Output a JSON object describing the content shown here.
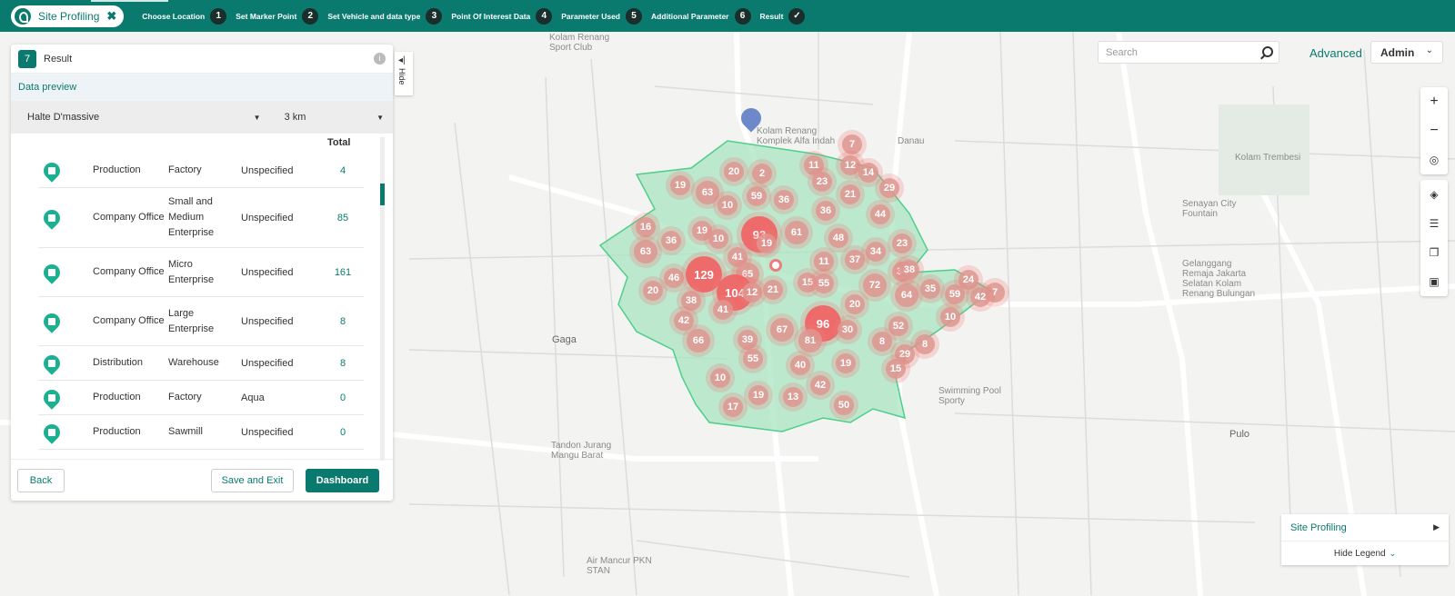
{
  "app": {
    "name": "Site Profiling",
    "close_symbol": "✖",
    "accent": "#0b7a6e"
  },
  "steps": [
    {
      "label": "Choose Location",
      "num": "1"
    },
    {
      "label": "Set Marker Point",
      "num": "2"
    },
    {
      "label": "Set Vehicle and data type",
      "num": "3"
    },
    {
      "label": "Point Of Interest Data",
      "num": "4"
    },
    {
      "label": "Parameter Used",
      "num": "5"
    },
    {
      "label": "Additional Parameter",
      "num": "6"
    },
    {
      "label": "Result",
      "num": "✓"
    }
  ],
  "panel": {
    "step_num": "7",
    "title": "Result",
    "info_symbol": "i",
    "preview_label": "Data preview",
    "location": "Halte D'massive",
    "radius": "3 km",
    "total_header": "Total",
    "rows": [
      {
        "icon": "factory-pin-icon",
        "group": "Production",
        "category": "Factory",
        "brand": "Unspecified",
        "total": "4"
      },
      {
        "icon": "office-pin-icon",
        "group": "Company Office",
        "category": "Small and Medium Enterprise",
        "brand": "Unspecified",
        "total": "85"
      },
      {
        "icon": "office-pin-icon",
        "group": "Company Office",
        "category": "Micro Enterprise",
        "brand": "Unspecified",
        "total": "161"
      },
      {
        "icon": "office-pin-icon",
        "group": "Company Office",
        "category": "Large Enterprise",
        "brand": "Unspecified",
        "total": "8"
      },
      {
        "icon": "warehouse-pin-icon",
        "group": "Distribution",
        "category": "Warehouse",
        "brand": "Unspecified",
        "total": "8"
      },
      {
        "icon": "factory-pin-icon",
        "group": "Production",
        "category": "Factory",
        "brand": "Aqua",
        "total": "0"
      },
      {
        "icon": "sawmill-pin-icon",
        "group": "Production",
        "category": "Sawmill",
        "brand": "Unspecified",
        "total": "0"
      }
    ],
    "back": "Back",
    "save_exit": "Save and Exit",
    "dashboard": "Dashboard",
    "hide": "Hide",
    "hide_arrow": "◂|"
  },
  "search": {
    "placeholder": "Search"
  },
  "advanced": "Advanced",
  "admin": "Admin",
  "map_tools": {
    "zoom_in": "+",
    "zoom_out": "−"
  },
  "legend": {
    "item": "Site Profiling",
    "hide": "Hide Legend"
  },
  "map_labels": [
    "Kolam Renang Sport Club",
    "Gaga",
    "Pulo",
    "Kolam Renang Komplek Alfa Indah",
    "Danau",
    "Senayan City Fountain",
    "Swimming Pool Sporty",
    "Tandon Jurang Mangu Barat",
    "Air Mancur PKN STAN",
    "Kolam Trembesi",
    "Gelanggang Remaja Jakarta Selatan Kolam Renang Bulungan"
  ],
  "clusters": [
    {
      "v": "7"
    },
    {
      "v": "11"
    },
    {
      "v": "12"
    },
    {
      "v": "14"
    },
    {
      "v": "20"
    },
    {
      "v": "2"
    },
    {
      "v": "23"
    },
    {
      "v": "19"
    },
    {
      "v": "63"
    },
    {
      "v": "59"
    },
    {
      "v": "36"
    },
    {
      "v": "21"
    },
    {
      "v": "29"
    },
    {
      "v": "10"
    },
    {
      "v": "36"
    },
    {
      "v": "44"
    },
    {
      "v": "16"
    },
    {
      "v": "36"
    },
    {
      "v": "19"
    },
    {
      "v": "10"
    },
    {
      "v": "93"
    },
    {
      "v": "19"
    },
    {
      "v": "61"
    },
    {
      "v": "48"
    },
    {
      "v": "23"
    },
    {
      "v": "34"
    },
    {
      "v": "63"
    },
    {
      "v": "41"
    },
    {
      "v": "11"
    },
    {
      "v": "37"
    },
    {
      "v": "34"
    },
    {
      "v": "46"
    },
    {
      "v": "129"
    },
    {
      "v": "65"
    },
    {
      "v": "38"
    },
    {
      "v": "24"
    },
    {
      "v": "7"
    },
    {
      "v": "20"
    },
    {
      "v": "104"
    },
    {
      "v": "12"
    },
    {
      "v": "21"
    },
    {
      "v": "15"
    },
    {
      "v": "55"
    },
    {
      "v": "72"
    },
    {
      "v": "64"
    },
    {
      "v": "35"
    },
    {
      "v": "59"
    },
    {
      "v": "42"
    },
    {
      "v": "38"
    },
    {
      "v": "41"
    },
    {
      "v": "20"
    },
    {
      "v": "10"
    },
    {
      "v": "42"
    },
    {
      "v": "96"
    },
    {
      "v": "67"
    },
    {
      "v": "30"
    },
    {
      "v": "52"
    },
    {
      "v": "66"
    },
    {
      "v": "39"
    },
    {
      "v": "81"
    },
    {
      "v": "8"
    },
    {
      "v": "8"
    },
    {
      "v": "29"
    },
    {
      "v": "55"
    },
    {
      "v": "40"
    },
    {
      "v": "19"
    },
    {
      "v": "15"
    },
    {
      "v": "10"
    },
    {
      "v": "42"
    },
    {
      "v": "19"
    },
    {
      "v": "13"
    },
    {
      "v": "17"
    },
    {
      "v": "50"
    }
  ]
}
